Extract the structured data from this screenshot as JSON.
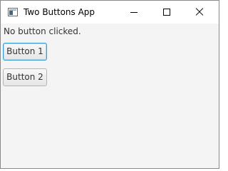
{
  "window": {
    "title": "Two Buttons App",
    "icon": "app-window-icon"
  },
  "titlebar_controls": {
    "minimize_icon": "minimize-icon",
    "maximize_icon": "maximize-icon",
    "close_icon": "close-icon"
  },
  "main": {
    "status_text": "No button clicked.",
    "buttons": [
      {
        "label": "Button 1",
        "focused": true
      },
      {
        "label": "Button 2",
        "focused": false
      }
    ]
  },
  "colors": {
    "focus_border": "#3ca0d0",
    "content_background": "#f4f4f4"
  }
}
